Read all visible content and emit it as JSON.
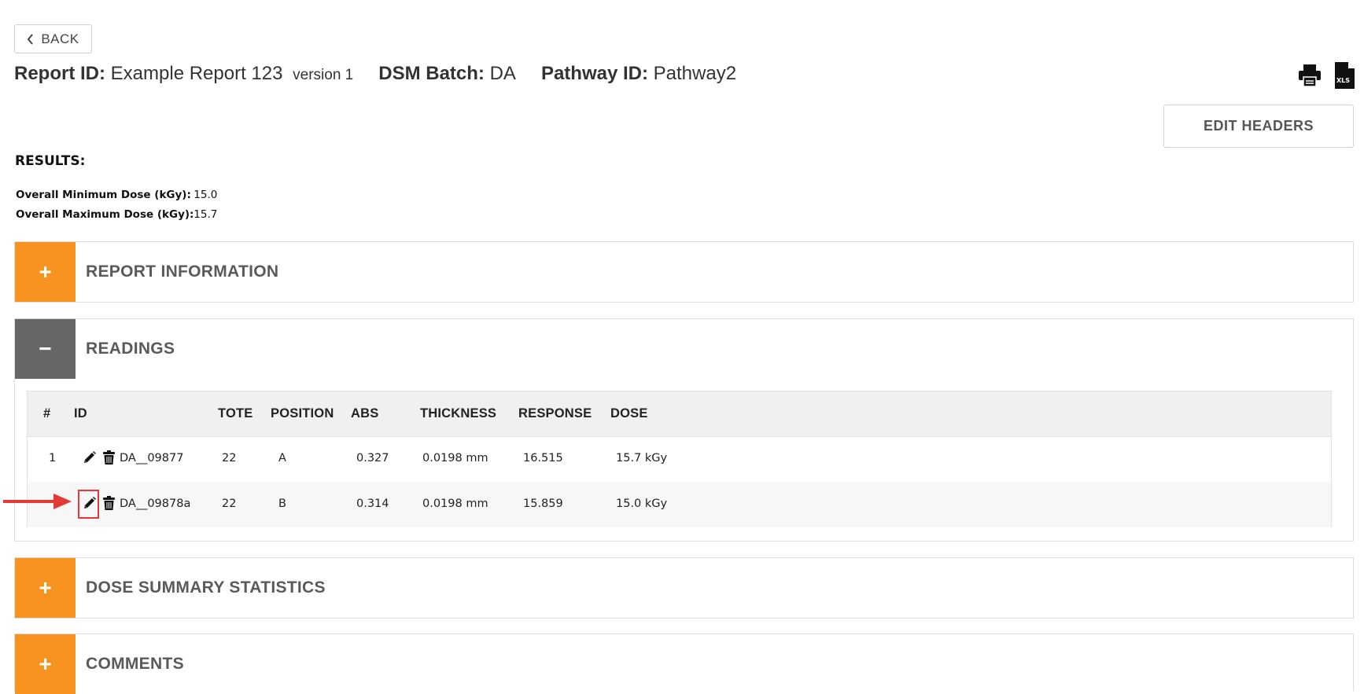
{
  "back_button": {
    "label": "BACK"
  },
  "header": {
    "report_id_label": "Report ID:",
    "report_id_value": "Example Report 123",
    "version": "version 1",
    "dsm_batch_label": "DSM Batch:",
    "dsm_batch_value": "DA",
    "pathway_label": "Pathway ID:",
    "pathway_value": "Pathway2"
  },
  "toolbar": {
    "edit_headers_label": "EDIT HEADERS",
    "xls_label": "XLS"
  },
  "results": {
    "title": "RESULTS:",
    "min_label": "Overall Minimum Dose (kGy):",
    "min_value": "15.0",
    "max_label": "Overall Maximum Dose (kGy):",
    "max_value": "15.7"
  },
  "panels": {
    "report_information": {
      "title": "REPORT INFORMATION",
      "toggle": "+"
    },
    "readings": {
      "title": "READINGS",
      "toggle": "−"
    },
    "dose_summary": {
      "title": "DOSE SUMMARY STATISTICS",
      "toggle": "+"
    },
    "comments": {
      "title": "COMMENTS",
      "toggle": "+"
    }
  },
  "readings_table": {
    "columns": [
      "#",
      "ID",
      "TOTE",
      "POSITION",
      "ABS",
      "THICKNESS",
      "RESPONSE",
      "DOSE"
    ],
    "rows": [
      {
        "num": "1",
        "id": "DA__09877",
        "tote": "22",
        "position": "A",
        "abs": "0.327",
        "thickness": "0.0198 mm",
        "response": "16.515",
        "dose": "15.7  kGy"
      },
      {
        "num": "",
        "id": "DA__09878a",
        "tote": "22",
        "position": "B",
        "abs": "0.314",
        "thickness": "0.0198 mm",
        "response": "15.859",
        "dose": "15.0  kGy"
      }
    ]
  },
  "colors": {
    "accent_orange": "#f7931e",
    "toggle_gray": "#666666",
    "highlight_red": "#e53935"
  }
}
